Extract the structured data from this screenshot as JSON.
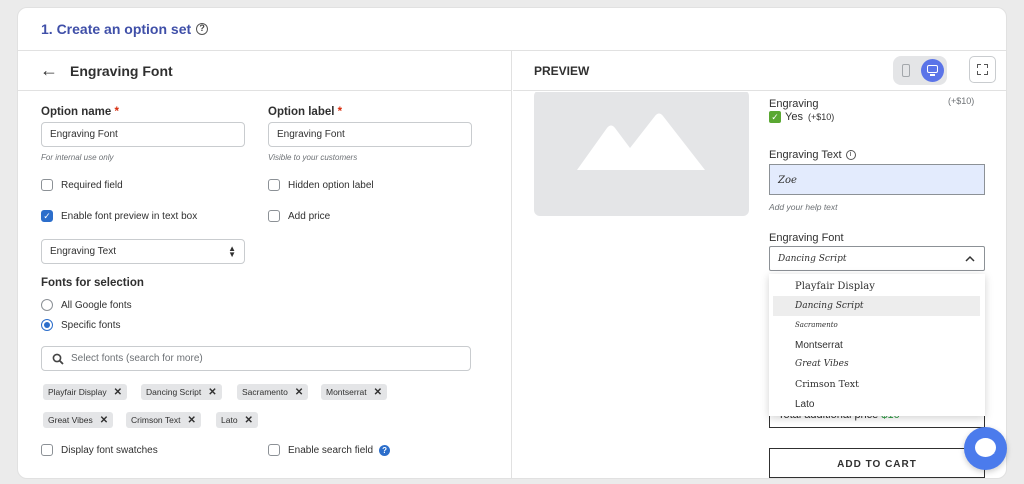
{
  "header": {
    "title": "1. Create an option set",
    "help_icon": "help-circle-icon"
  },
  "editor": {
    "title": "Engraving Font",
    "option_name": {
      "label": "Option name",
      "required_mark": "*",
      "value": "Engraving Font",
      "hint": "For internal use only"
    },
    "option_label": {
      "label": "Option label",
      "required_mark": "*",
      "value": "Engraving Font",
      "hint": "Visible to your customers"
    },
    "checkboxes": {
      "required_field": {
        "label": "Required field",
        "checked": false
      },
      "hidden_option_label": {
        "label": "Hidden option label",
        "checked": false
      },
      "enable_font_preview": {
        "label": "Enable font preview in text box",
        "checked": true
      },
      "add_price": {
        "label": "Add price",
        "checked": false
      },
      "display_font_swatches": {
        "label": "Display font swatches",
        "checked": false
      },
      "enable_search_field": {
        "label": "Enable search field",
        "checked": false
      }
    },
    "target_select": {
      "value": "Engraving Text"
    },
    "fonts_for_selection": {
      "label": "Fonts for selection",
      "options": [
        {
          "label": "All Google fonts",
          "selected": false
        },
        {
          "label": "Specific fonts",
          "selected": true
        }
      ]
    },
    "font_search": {
      "placeholder": "Select fonts (search for more)"
    },
    "selected_fonts": [
      "Playfair Display",
      "Dancing Script",
      "Sacramento",
      "Montserrat",
      "Great Vibes",
      "Crimson Text",
      "Lato"
    ]
  },
  "preview": {
    "title": "PREVIEW",
    "engraving": {
      "label": "Engraving",
      "price": "(+$10)",
      "option": "Yes",
      "option_price": "(+$10)"
    },
    "engraving_text": {
      "label": "Engraving Text",
      "value": "Zoe",
      "help": "Add your help text"
    },
    "engraving_font": {
      "label": "Engraving Font",
      "value": "Dancing Script"
    },
    "dropdown_fonts": [
      "Playfair Display",
      "Dancing Script",
      "Sacramento",
      "Montserrat",
      "Great Vibes",
      "Crimson Text",
      "Lato"
    ],
    "dropdown_selected": "Dancing Script",
    "total": {
      "label": "Total additional price",
      "value": "$10"
    },
    "add_to_cart": "ADD TO CART",
    "colors": {
      "accent": "#2c6ecb",
      "title_blue": "#3f4fa8",
      "price_green": "#2e9e44",
      "text_box_bg": "#e3ebfd"
    }
  }
}
